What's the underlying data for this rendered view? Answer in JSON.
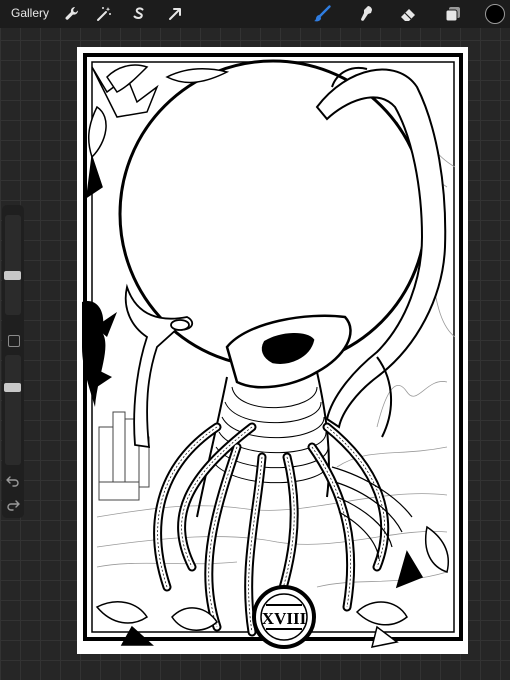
{
  "toolbar": {
    "gallery_label": "Gallery",
    "left_tools": [
      "wrench-icon",
      "magic-wand-icon",
      "selection-s-icon",
      "transform-arrow-icon"
    ],
    "right_tools": [
      "brush-icon",
      "smudge-icon",
      "eraser-icon",
      "layers-icon"
    ],
    "active_tool": "brush",
    "active_color": "#000000",
    "accent": "#2f7de1"
  },
  "sidebar": {
    "brush_size_level": 0.38,
    "opacity_level": 0.72,
    "undo_icon": "undo-icon",
    "redo_icon": "redo-icon"
  },
  "artwork": {
    "card_numeral": "XVIII"
  }
}
